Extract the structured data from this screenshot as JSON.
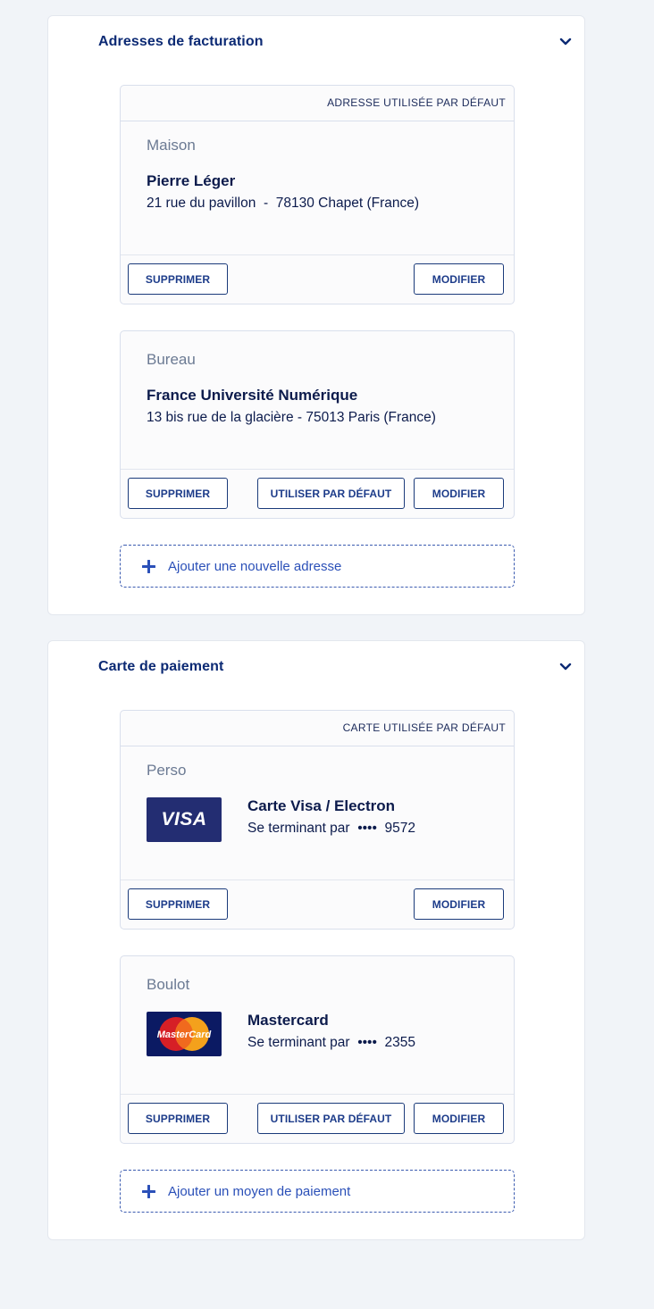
{
  "billing": {
    "title": "Adresses de facturation",
    "addresses": [
      {
        "default_label": "ADRESSE UTILISÉE PAR DÉFAUT",
        "label": "Maison",
        "name": "Pierre Léger",
        "address": "21 rue du pavillon  -  78130 Chapet (France)",
        "delete": "SUPPRIMER",
        "edit": "MODIFIER"
      },
      {
        "label": "Bureau",
        "name": "France Université Numérique",
        "address": "13 bis rue de la glacière - 75013 Paris (France)",
        "delete": "SUPPRIMER",
        "set_default": "UTILISER PAR DÉFAUT",
        "edit": "MODIFIER"
      }
    ],
    "add_label": "Ajouter une nouvelle adresse"
  },
  "payment": {
    "title": "Carte de paiement",
    "cards": [
      {
        "default_label": "CARTE UTILISÉE PAR DÉFAUT",
        "label": "Perso",
        "logo_text": "VISA",
        "type": "Carte Visa / Electron",
        "ending": "Se terminant par  ••••  9572",
        "delete": "SUPPRIMER",
        "edit": "MODIFIER"
      },
      {
        "label": "Boulot",
        "logo_text": "MasterCard",
        "type": "Mastercard",
        "ending": "Se terminant par  ••••  2355",
        "delete": "SUPPRIMER",
        "set_default": "UTILISER PAR DÉFAUT",
        "edit": "MODIFIER"
      }
    ],
    "add_label": "Ajouter un moyen de paiement"
  },
  "colors": {
    "accent": "#2b50b8",
    "title": "#0c2a74",
    "visa_bg": "#232d72",
    "mastercard_bg": "#0b1a63"
  },
  "icons": {
    "collapse": "chevron-down-icon",
    "add": "plus-icon"
  }
}
